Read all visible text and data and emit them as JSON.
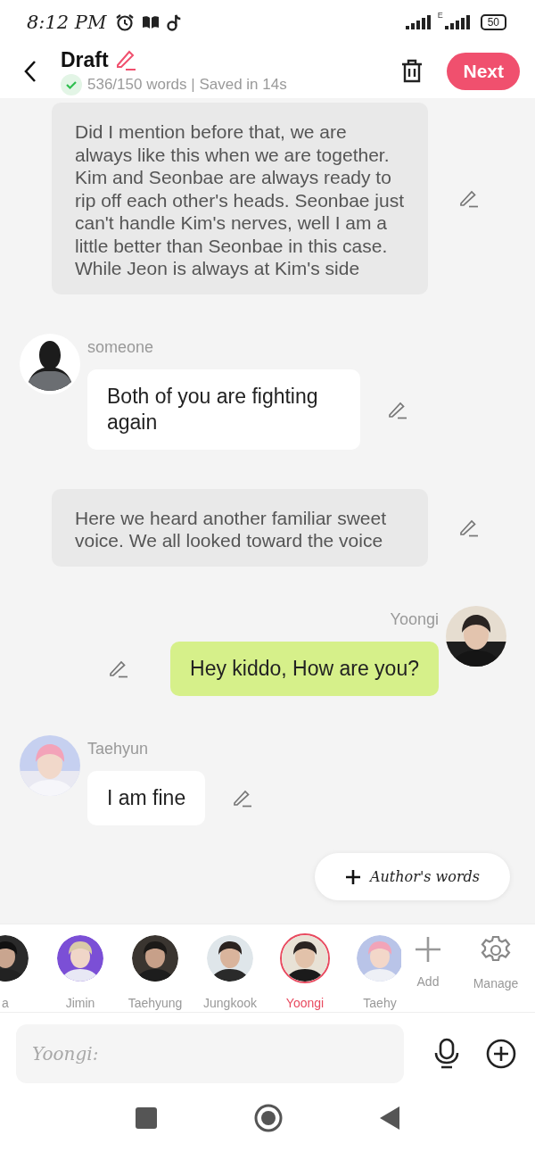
{
  "status_bar": {
    "time": "8:12 PM",
    "network_label": "E",
    "battery": "50"
  },
  "header": {
    "title": "Draft",
    "word_count": "536/150 words | Saved in 14s",
    "next_button": "Next"
  },
  "messages": [
    {
      "kind": "narration",
      "text": "Did I mention before that, we are always like this when we are together. Kim and Seonbae are always ready to rip off each other's heads. Seonbae just can't handle Kim's nerves, well I am a little better than Seonbae in this case. While Jeon is always at Kim's side"
    },
    {
      "kind": "left",
      "name": "someone",
      "avatar": {
        "kind": "silhouette"
      },
      "text": "Both of you are fighting again"
    },
    {
      "kind": "narration",
      "text": "Here we heard another familiar sweet voice. We all looked toward the voice"
    },
    {
      "kind": "right",
      "name": "Yoongi",
      "text": "Hey kiddo, How are you?"
    },
    {
      "kind": "left",
      "name": "Taehyun",
      "text": "I am fine"
    }
  ],
  "authors_words_button": "Author's words",
  "characters": [
    {
      "name": "a",
      "selected": false
    },
    {
      "name": "Jimin",
      "selected": false
    },
    {
      "name": "Taehyung",
      "selected": false
    },
    {
      "name": "Jungkook",
      "selected": false
    },
    {
      "name": "Yoongi",
      "selected": true
    },
    {
      "name": "Taehy",
      "selected": false
    }
  ],
  "add_label": "Add",
  "manage_label": "Manage",
  "input": {
    "placeholder": "Yoongi:"
  }
}
